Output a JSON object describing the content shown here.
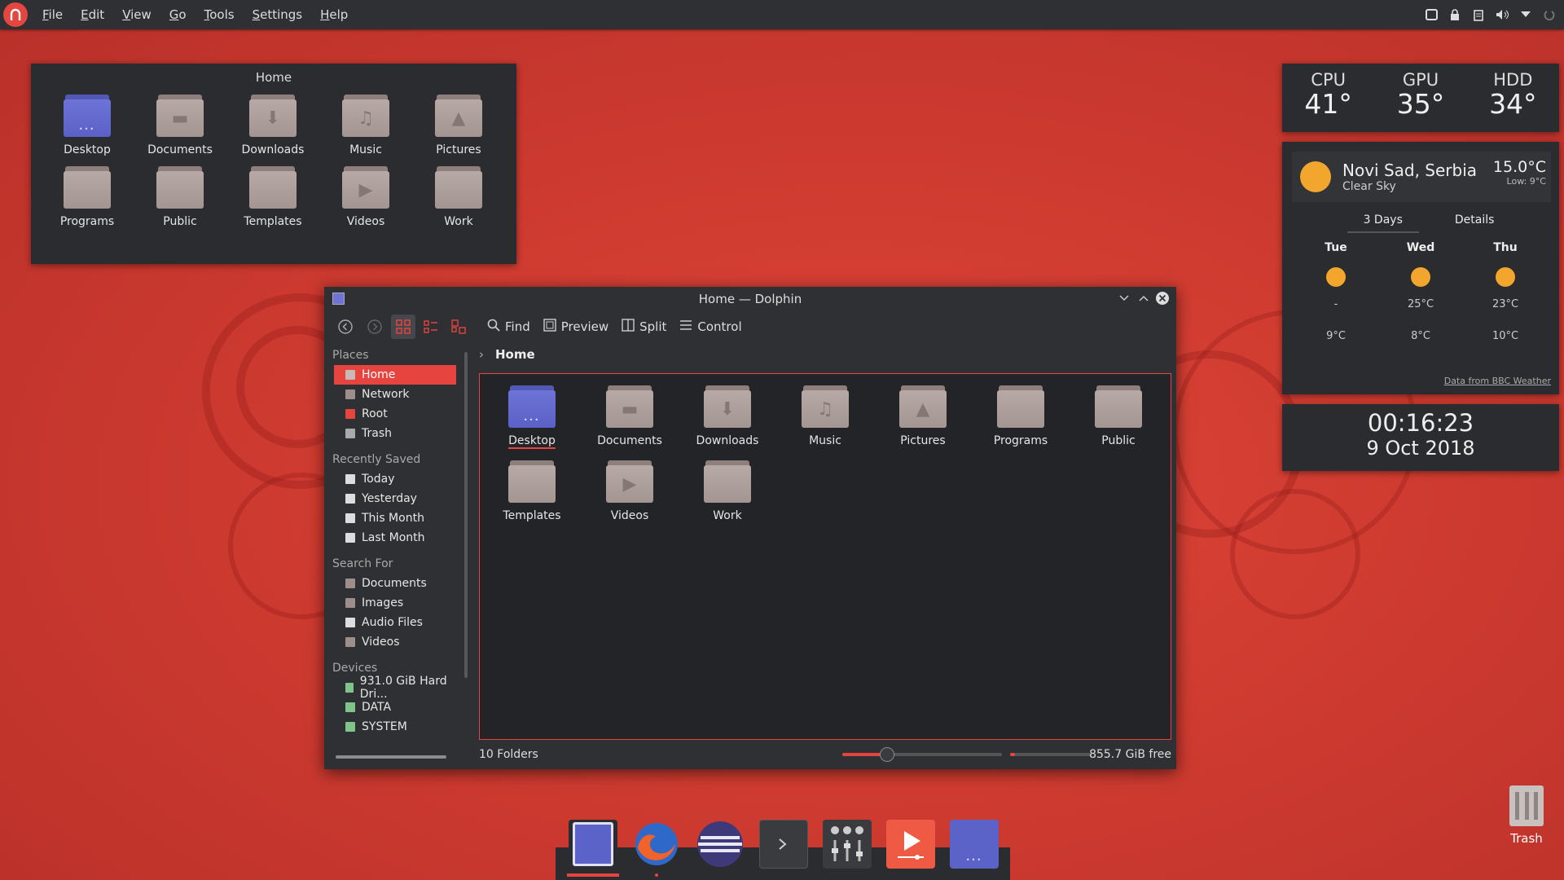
{
  "menubar": {
    "items": [
      "File",
      "Edit",
      "View",
      "Go",
      "Tools",
      "Settings",
      "Help"
    ],
    "tray_icons": [
      "window-icon",
      "lock-icon",
      "clipboard-icon",
      "volume-icon",
      "chevron-down-icon",
      "power-icon"
    ]
  },
  "folder_view": {
    "title": "Home",
    "items": [
      "Desktop",
      "Documents",
      "Downloads",
      "Music",
      "Pictures",
      "Programs",
      "Public",
      "Templates",
      "Videos",
      "Work"
    ]
  },
  "sensors": {
    "cpu": {
      "label": "CPU",
      "value": "41°"
    },
    "gpu": {
      "label": "GPU",
      "value": "35°"
    },
    "hdd": {
      "label": "HDD",
      "value": "34°"
    }
  },
  "weather": {
    "location": "Novi Sad, Serbia",
    "condition": "Clear Sky",
    "temp": "15.0°C",
    "low": "Low: 9°C",
    "tabs": [
      "3 Days",
      "Details"
    ],
    "days": [
      {
        "name": "Tue",
        "high": "-",
        "low": "9°C"
      },
      {
        "name": "Wed",
        "high": "25°C",
        "low": "8°C"
      },
      {
        "name": "Thu",
        "high": "23°C",
        "low": "10°C"
      }
    ],
    "source": "Data from BBC Weather"
  },
  "clock": {
    "time": "00:16:23",
    "date": "9 Oct 2018"
  },
  "dolphin": {
    "title": "Home — Dolphin",
    "toolbar": {
      "find": "Find",
      "preview": "Preview",
      "split": "Split",
      "control": "Control"
    },
    "breadcrumb": "Home",
    "places": {
      "places_header": "Places",
      "places": [
        "Home",
        "Network",
        "Root",
        "Trash"
      ],
      "recent_header": "Recently Saved",
      "recent": [
        "Today",
        "Yesterday",
        "This Month",
        "Last Month"
      ],
      "search_header": "Search For",
      "search": [
        "Documents",
        "Images",
        "Audio Files",
        "Videos"
      ],
      "devices_header": "Devices",
      "devices": [
        "931.0 GiB Hard Dri...",
        "DATA",
        "SYSTEM"
      ]
    },
    "items": [
      "Desktop",
      "Documents",
      "Downloads",
      "Music",
      "Pictures",
      "Programs",
      "Public",
      "Templates",
      "Videos",
      "Work"
    ],
    "status": "10 Folders",
    "free": "855.7 GiB free",
    "zoom_level": 0.28,
    "disk_used_fraction": 0.06
  },
  "desktop_trash": "Trash",
  "accent": "#e5453e"
}
